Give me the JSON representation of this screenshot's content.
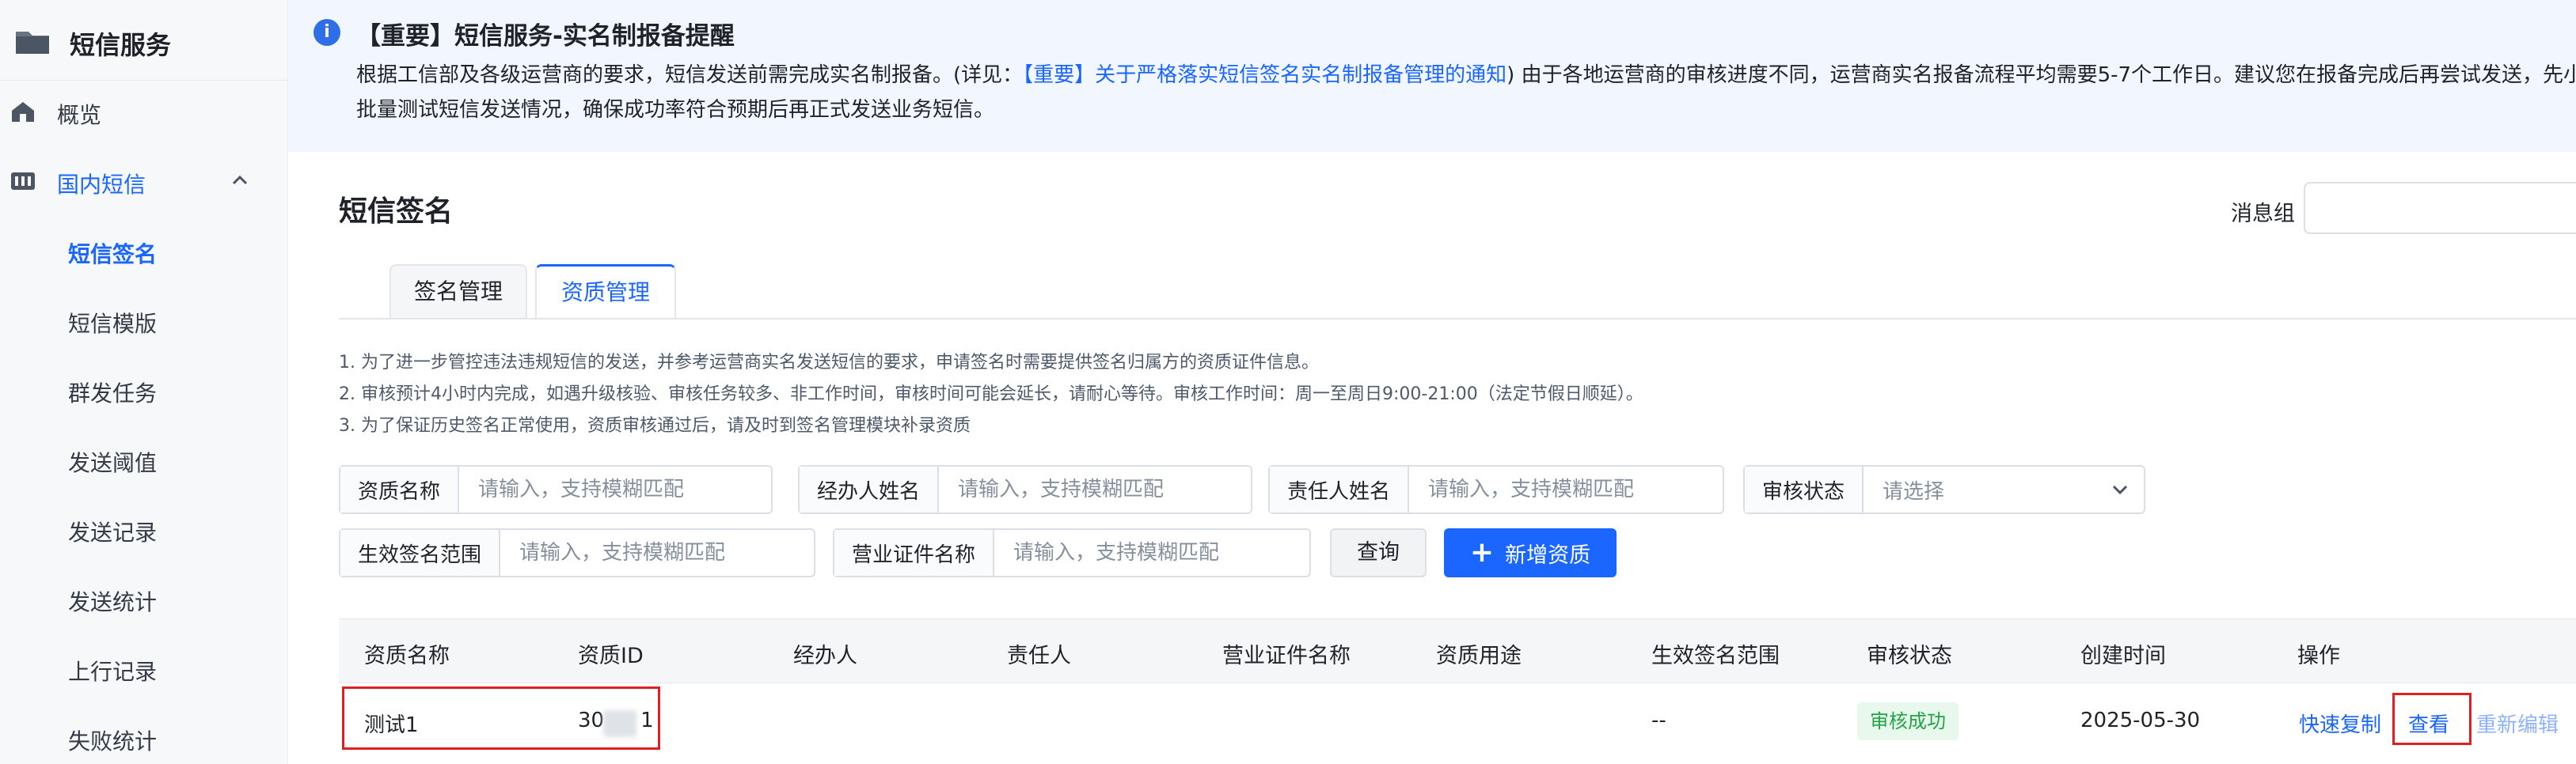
{
  "sidebar": {
    "brand_title": "短信服务",
    "overview_label": "概览",
    "group_label": "国内短信",
    "sub_items": [
      {
        "label": "短信签名",
        "active": true
      },
      {
        "label": "短信模版",
        "active": false
      },
      {
        "label": "群发任务",
        "active": false
      },
      {
        "label": "发送阈值",
        "active": false
      },
      {
        "label": "发送记录",
        "active": false
      },
      {
        "label": "发送统计",
        "active": false
      },
      {
        "label": "上行记录",
        "active": false
      },
      {
        "label": "失败统计",
        "active": false
      }
    ]
  },
  "notice": {
    "title": "【重要】短信服务-实名制报备提醒",
    "line1_before": "根据工信部及各级运营商的要求，短信发送前需完成实名制报备。(详见：",
    "line1_link": "【重要】关于严格落实短信签名实名制报备管理的通知",
    "line1_after": ") 由于各地运营商的审核进度不同，运营商实名报备流程平均需要5-7个工作日。建议您在报备完成后再尝试发送，先小",
    "line2": "批量测试短信发送情况，确保成功率符合预期后再正式发送业务短信。"
  },
  "page": {
    "title": "短信签名",
    "message_group_label": "消息组"
  },
  "tabs": [
    {
      "label": "签名管理",
      "active": false
    },
    {
      "label": "资质管理",
      "active": true
    }
  ],
  "tips": [
    "1. 为了进一步管控违法违规短信的发送，并参考运营商实名发送短信的要求，申请签名时需要提供签名归属方的资质证件信息。",
    "2. 审核预计4小时内完成，如遇升级核验、审核任务较多、非工作时间，审核时间可能会延长，请耐心等待。审核工作时间：周一至周日9:00-21:00（法定节假日顺延）。",
    "3. 为了保证历史签名正常使用，资质审核通过后，请及时到签名管理模块补录资质"
  ],
  "filters": {
    "qual_name": {
      "label": "资质名称",
      "placeholder": "请输入，支持模糊匹配"
    },
    "handler_name": {
      "label": "经办人姓名",
      "placeholder": "请输入，支持模糊匹配"
    },
    "owner_name": {
      "label": "责任人姓名",
      "placeholder": "请输入，支持模糊匹配"
    },
    "review_status": {
      "label": "审核状态",
      "placeholder": "请选择"
    },
    "effective_scope": {
      "label": "生效签名范围",
      "placeholder": "请输入，支持模糊匹配"
    },
    "license_name": {
      "label": "营业证件名称",
      "placeholder": "请输入，支持模糊匹配"
    }
  },
  "buttons": {
    "query": "查询",
    "add": "新增资质"
  },
  "table": {
    "headers": [
      "资质名称",
      "资质ID",
      "经办人",
      "责任人",
      "营业证件名称",
      "资质用途",
      "生效签名范围",
      "审核状态",
      "创建时间",
      "操作"
    ],
    "rows": [
      {
        "name": "测试1",
        "id_prefix": "30",
        "id_suffix": "1",
        "handler": "",
        "owner": "",
        "license": "",
        "usage": "",
        "scope": "--",
        "status": "审核成功",
        "created": "2025-05-30",
        "actions": [
          "快速复制",
          "查看",
          "重新编辑"
        ]
      }
    ]
  },
  "colors": {
    "accent": "#1a66ff",
    "success_text": "#22a447",
    "success_bg": "#e8f8ec",
    "highlight_box": "#e02020",
    "notice_bg": "#f2f6ff"
  }
}
